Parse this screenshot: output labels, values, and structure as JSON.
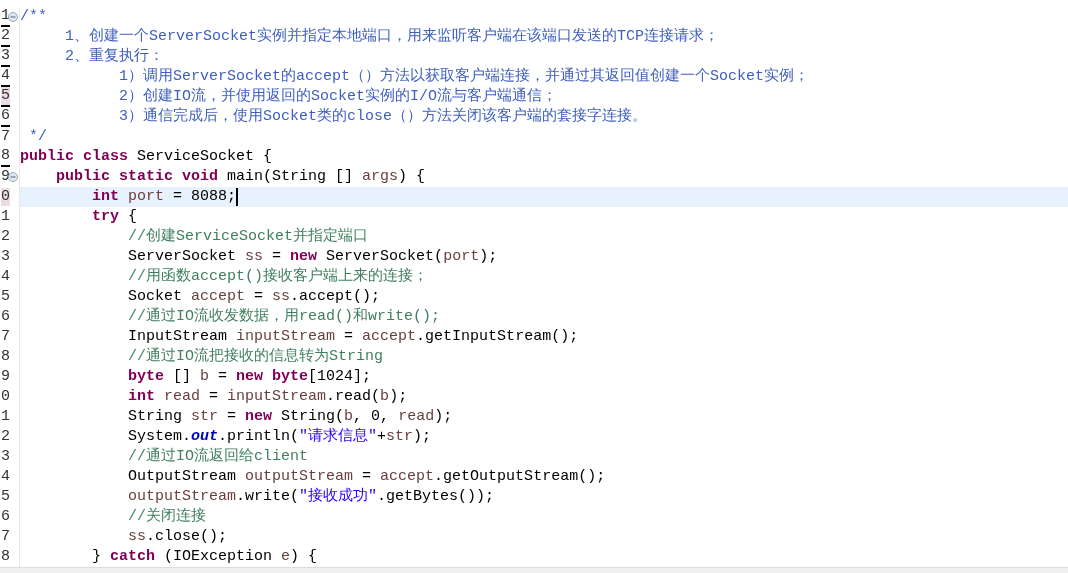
{
  "editor": {
    "lines": [
      {
        "number": "1",
        "foldable": true,
        "underlined": true,
        "marked": false,
        "current": false,
        "tokens": [
          {
            "t": "/**",
            "kind": "doc"
          }
        ]
      },
      {
        "number": "2",
        "foldable": false,
        "underlined": true,
        "marked": false,
        "current": false,
        "tokens": [
          {
            "t": "     1、创建一个ServerSocket实例并指定本地端口，用来监听客户端在该端口发送的TCP连接请求；",
            "kind": "doc"
          }
        ]
      },
      {
        "number": "3",
        "foldable": false,
        "underlined": true,
        "marked": false,
        "current": false,
        "tokens": [
          {
            "t": "     2、重复执行：",
            "kind": "doc"
          }
        ]
      },
      {
        "number": "4",
        "foldable": false,
        "underlined": true,
        "marked": false,
        "current": false,
        "tokens": [
          {
            "t": "           1）调用ServerSocket的accept（）方法以获取客户端连接，并通过其返回值创建一个Socket实例；",
            "kind": "doc"
          }
        ]
      },
      {
        "number": "5",
        "foldable": false,
        "underlined": true,
        "marked": true,
        "current": false,
        "tokens": [
          {
            "t": "           2）创建IO流，并使用返回的Socket实例的I/O流与客户端通信；",
            "kind": "doc"
          }
        ]
      },
      {
        "number": "6",
        "foldable": false,
        "underlined": true,
        "marked": false,
        "current": false,
        "tokens": [
          {
            "t": "           3）通信完成后，使用Socket类的close（）方法关闭该客户端的套接字连接。",
            "kind": "doc"
          }
        ]
      },
      {
        "number": "7",
        "foldable": false,
        "underlined": false,
        "marked": false,
        "current": false,
        "tokens": [
          {
            "t": " */",
            "kind": "doc"
          }
        ]
      },
      {
        "number": "8",
        "foldable": false,
        "underlined": true,
        "marked": false,
        "current": false,
        "tokens": [
          {
            "t": "public class",
            "kind": "kw"
          },
          {
            "t": " ServiceSocket {",
            "kind": "pl"
          }
        ]
      },
      {
        "number": "9",
        "foldable": true,
        "underlined": false,
        "marked": false,
        "current": false,
        "tokens": [
          {
            "t": "    public static void",
            "kind": "kw"
          },
          {
            "t": " main(String [] ",
            "kind": "pl"
          },
          {
            "t": "args",
            "kind": "var"
          },
          {
            "t": ") {",
            "kind": "pl"
          }
        ]
      },
      {
        "number": "0",
        "foldable": false,
        "underlined": false,
        "marked": true,
        "current": true,
        "tokens": [
          {
            "t": "        int ",
            "kind": "kw"
          },
          {
            "t": "port",
            "kind": "var"
          },
          {
            "t": " = 8088;",
            "kind": "pl"
          }
        ]
      },
      {
        "number": "1",
        "foldable": false,
        "underlined": false,
        "marked": false,
        "current": false,
        "tokens": [
          {
            "t": "        try",
            "kind": "kw"
          },
          {
            "t": " {",
            "kind": "pl"
          }
        ]
      },
      {
        "number": "2",
        "foldable": false,
        "underlined": false,
        "marked": false,
        "current": false,
        "tokens": [
          {
            "t": "            //创建ServiceSocket并指定端口",
            "kind": "cm"
          }
        ]
      },
      {
        "number": "3",
        "foldable": false,
        "underlined": false,
        "marked": false,
        "current": false,
        "tokens": [
          {
            "t": "            ServerSocket ",
            "kind": "pl"
          },
          {
            "t": "ss",
            "kind": "var"
          },
          {
            "t": " = ",
            "kind": "pl"
          },
          {
            "t": "new",
            "kind": "kw"
          },
          {
            "t": " ServerSocket(",
            "kind": "pl"
          },
          {
            "t": "port",
            "kind": "var"
          },
          {
            "t": ");",
            "kind": "pl"
          }
        ]
      },
      {
        "number": "4",
        "foldable": false,
        "underlined": false,
        "marked": false,
        "current": false,
        "tokens": [
          {
            "t": "            //用函数accept()接收客户端上来的连接；",
            "kind": "cm"
          }
        ]
      },
      {
        "number": "5",
        "foldable": false,
        "underlined": false,
        "marked": false,
        "current": false,
        "tokens": [
          {
            "t": "            Socket ",
            "kind": "pl"
          },
          {
            "t": "accept",
            "kind": "var"
          },
          {
            "t": " = ",
            "kind": "pl"
          },
          {
            "t": "ss",
            "kind": "var"
          },
          {
            "t": ".accept();",
            "kind": "pl"
          }
        ]
      },
      {
        "number": "6",
        "foldable": false,
        "underlined": false,
        "marked": false,
        "current": false,
        "tokens": [
          {
            "t": "            //通过IO流收发数据，用read()和write();",
            "kind": "cm"
          }
        ]
      },
      {
        "number": "7",
        "foldable": false,
        "underlined": false,
        "marked": false,
        "current": false,
        "tokens": [
          {
            "t": "            InputStream ",
            "kind": "pl"
          },
          {
            "t": "inputStream",
            "kind": "var"
          },
          {
            "t": " = ",
            "kind": "pl"
          },
          {
            "t": "accept",
            "kind": "var"
          },
          {
            "t": ".getInputStream();",
            "kind": "pl"
          }
        ]
      },
      {
        "number": "8",
        "foldable": false,
        "underlined": false,
        "marked": false,
        "current": false,
        "tokens": [
          {
            "t": "            //通过IO流把接收的信息转为String",
            "kind": "cm"
          }
        ]
      },
      {
        "number": "9",
        "foldable": false,
        "underlined": false,
        "marked": false,
        "current": false,
        "tokens": [
          {
            "t": "            byte",
            "kind": "kw"
          },
          {
            "t": " [] ",
            "kind": "pl"
          },
          {
            "t": "b",
            "kind": "var"
          },
          {
            "t": " = ",
            "kind": "pl"
          },
          {
            "t": "new byte",
            "kind": "kw"
          },
          {
            "t": "[1024];",
            "kind": "pl"
          }
        ]
      },
      {
        "number": "0",
        "foldable": false,
        "underlined": false,
        "marked": false,
        "current": false,
        "tokens": [
          {
            "t": "            int ",
            "kind": "kw"
          },
          {
            "t": "read",
            "kind": "var"
          },
          {
            "t": " = ",
            "kind": "pl"
          },
          {
            "t": "inputStream",
            "kind": "var"
          },
          {
            "t": ".read(",
            "kind": "pl"
          },
          {
            "t": "b",
            "kind": "var"
          },
          {
            "t": ");",
            "kind": "pl"
          }
        ]
      },
      {
        "number": "1",
        "foldable": false,
        "underlined": false,
        "marked": false,
        "current": false,
        "tokens": [
          {
            "t": "            String ",
            "kind": "pl"
          },
          {
            "t": "str",
            "kind": "var"
          },
          {
            "t": " = ",
            "kind": "pl"
          },
          {
            "t": "new",
            "kind": "kw"
          },
          {
            "t": " String(",
            "kind": "pl"
          },
          {
            "t": "b",
            "kind": "var"
          },
          {
            "t": ", 0, ",
            "kind": "pl"
          },
          {
            "t": "read",
            "kind": "var"
          },
          {
            "t": ");",
            "kind": "pl"
          }
        ]
      },
      {
        "number": "2",
        "foldable": false,
        "underlined": false,
        "marked": false,
        "current": false,
        "tokens": [
          {
            "t": "            System.",
            "kind": "pl"
          },
          {
            "t": "out",
            "kind": "field"
          },
          {
            "t": ".println(",
            "kind": "pl"
          },
          {
            "t": "\"请求信息\"",
            "kind": "str"
          },
          {
            "t": "+",
            "kind": "pl"
          },
          {
            "t": "str",
            "kind": "var"
          },
          {
            "t": ");",
            "kind": "pl"
          }
        ]
      },
      {
        "number": "3",
        "foldable": false,
        "underlined": false,
        "marked": false,
        "current": false,
        "tokens": [
          {
            "t": "            //通过IO流返回给client",
            "kind": "cm"
          }
        ]
      },
      {
        "number": "4",
        "foldable": false,
        "underlined": false,
        "marked": false,
        "current": false,
        "tokens": [
          {
            "t": "            OutputStream ",
            "kind": "pl"
          },
          {
            "t": "outputStream",
            "kind": "var"
          },
          {
            "t": " = ",
            "kind": "pl"
          },
          {
            "t": "accept",
            "kind": "var"
          },
          {
            "t": ".getOutputStream();",
            "kind": "pl"
          }
        ]
      },
      {
        "number": "5",
        "foldable": false,
        "underlined": false,
        "marked": false,
        "current": false,
        "tokens": [
          {
            "t": "            outputStream",
            "kind": "var"
          },
          {
            "t": ".write(",
            "kind": "pl"
          },
          {
            "t": "\"接收成功\"",
            "kind": "str"
          },
          {
            "t": ".getBytes());",
            "kind": "pl"
          }
        ]
      },
      {
        "number": "6",
        "foldable": false,
        "underlined": false,
        "marked": false,
        "current": false,
        "tokens": [
          {
            "t": "            //关闭连接",
            "kind": "cm"
          }
        ]
      },
      {
        "number": "7",
        "foldable": false,
        "underlined": false,
        "marked": false,
        "current": false,
        "tokens": [
          {
            "t": "            ss",
            "kind": "var"
          },
          {
            "t": ".close();",
            "kind": "pl"
          }
        ]
      },
      {
        "number": "8",
        "foldable": false,
        "underlined": false,
        "marked": false,
        "current": false,
        "tokens": [
          {
            "t": "        } ",
            "kind": "pl"
          },
          {
            "t": "catch",
            "kind": "kw"
          },
          {
            "t": " (IOException ",
            "kind": "pl"
          },
          {
            "t": "e",
            "kind": "var"
          },
          {
            "t": ") {",
            "kind": "pl"
          }
        ]
      }
    ]
  }
}
